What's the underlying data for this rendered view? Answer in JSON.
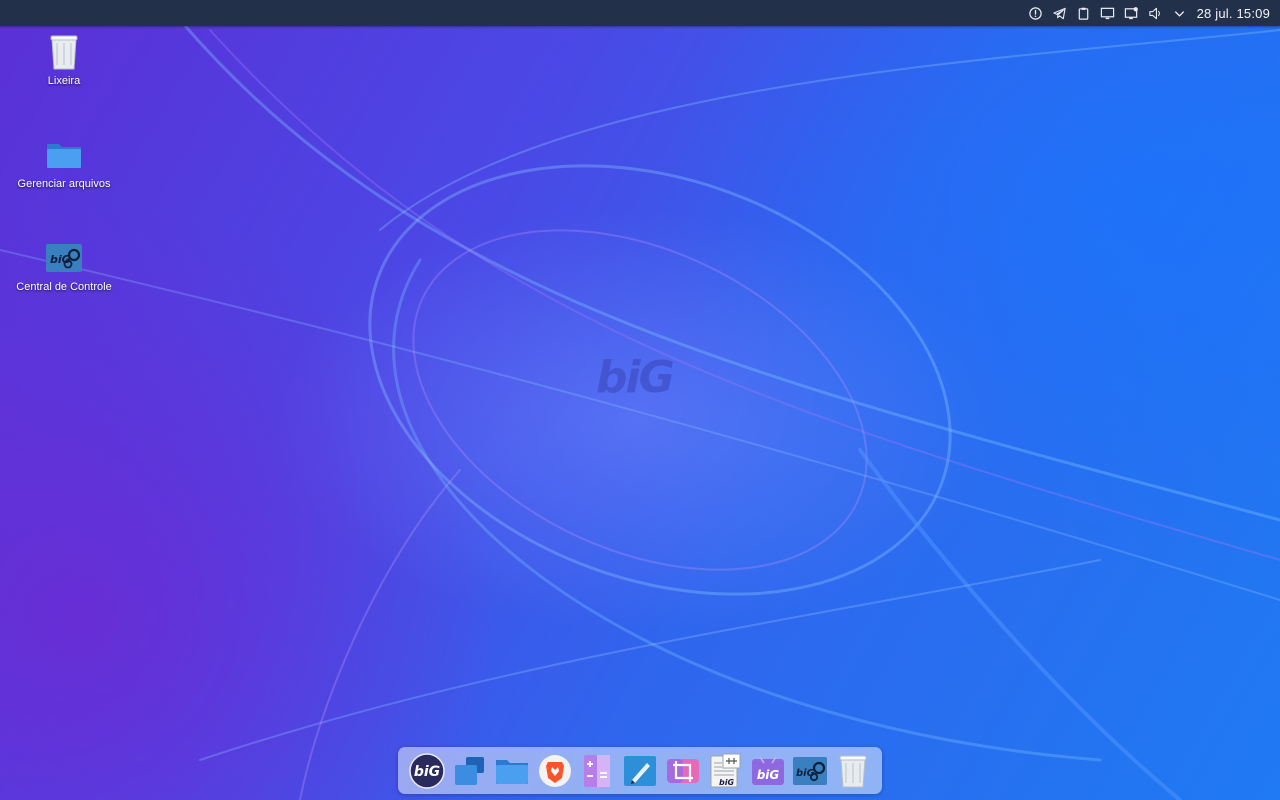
{
  "top_panel": {
    "tray_icons": [
      "info-icon",
      "telegram-icon",
      "clipboard-icon",
      "display-icon",
      "screen-share-icon",
      "volume-icon",
      "chevron-down-icon"
    ],
    "clock": "28 jul. 15:09"
  },
  "desktop": {
    "items": [
      {
        "label": "Lixeira",
        "icon": "trash-icon"
      },
      {
        "label": "Gerenciar arquivos",
        "icon": "folder-icon"
      },
      {
        "label": "Central de Controle",
        "icon": "control-center-icon"
      }
    ],
    "wallpaper_logo": "biG"
  },
  "dock": {
    "apps": [
      {
        "icon": "bigcommunity-icon",
        "text": "biG"
      },
      {
        "icon": "workspaces-icon"
      },
      {
        "icon": "files-icon"
      },
      {
        "icon": "brave-browser-icon"
      },
      {
        "icon": "calculator-icon"
      },
      {
        "icon": "text-editor-icon"
      },
      {
        "icon": "screenshot-icon"
      },
      {
        "icon": "document-scanner-icon",
        "text": "biG"
      },
      {
        "icon": "big-welcome-icon",
        "text": "biG"
      },
      {
        "icon": "control-center-icon",
        "text": "biG"
      },
      {
        "icon": "trash-icon"
      }
    ]
  },
  "colors": {
    "panel": "#22304a",
    "wallpaper_primary": "#2f66ee",
    "wallpaper_secondary": "#5b2fd6",
    "folder_blue": "#3d8fe0"
  }
}
